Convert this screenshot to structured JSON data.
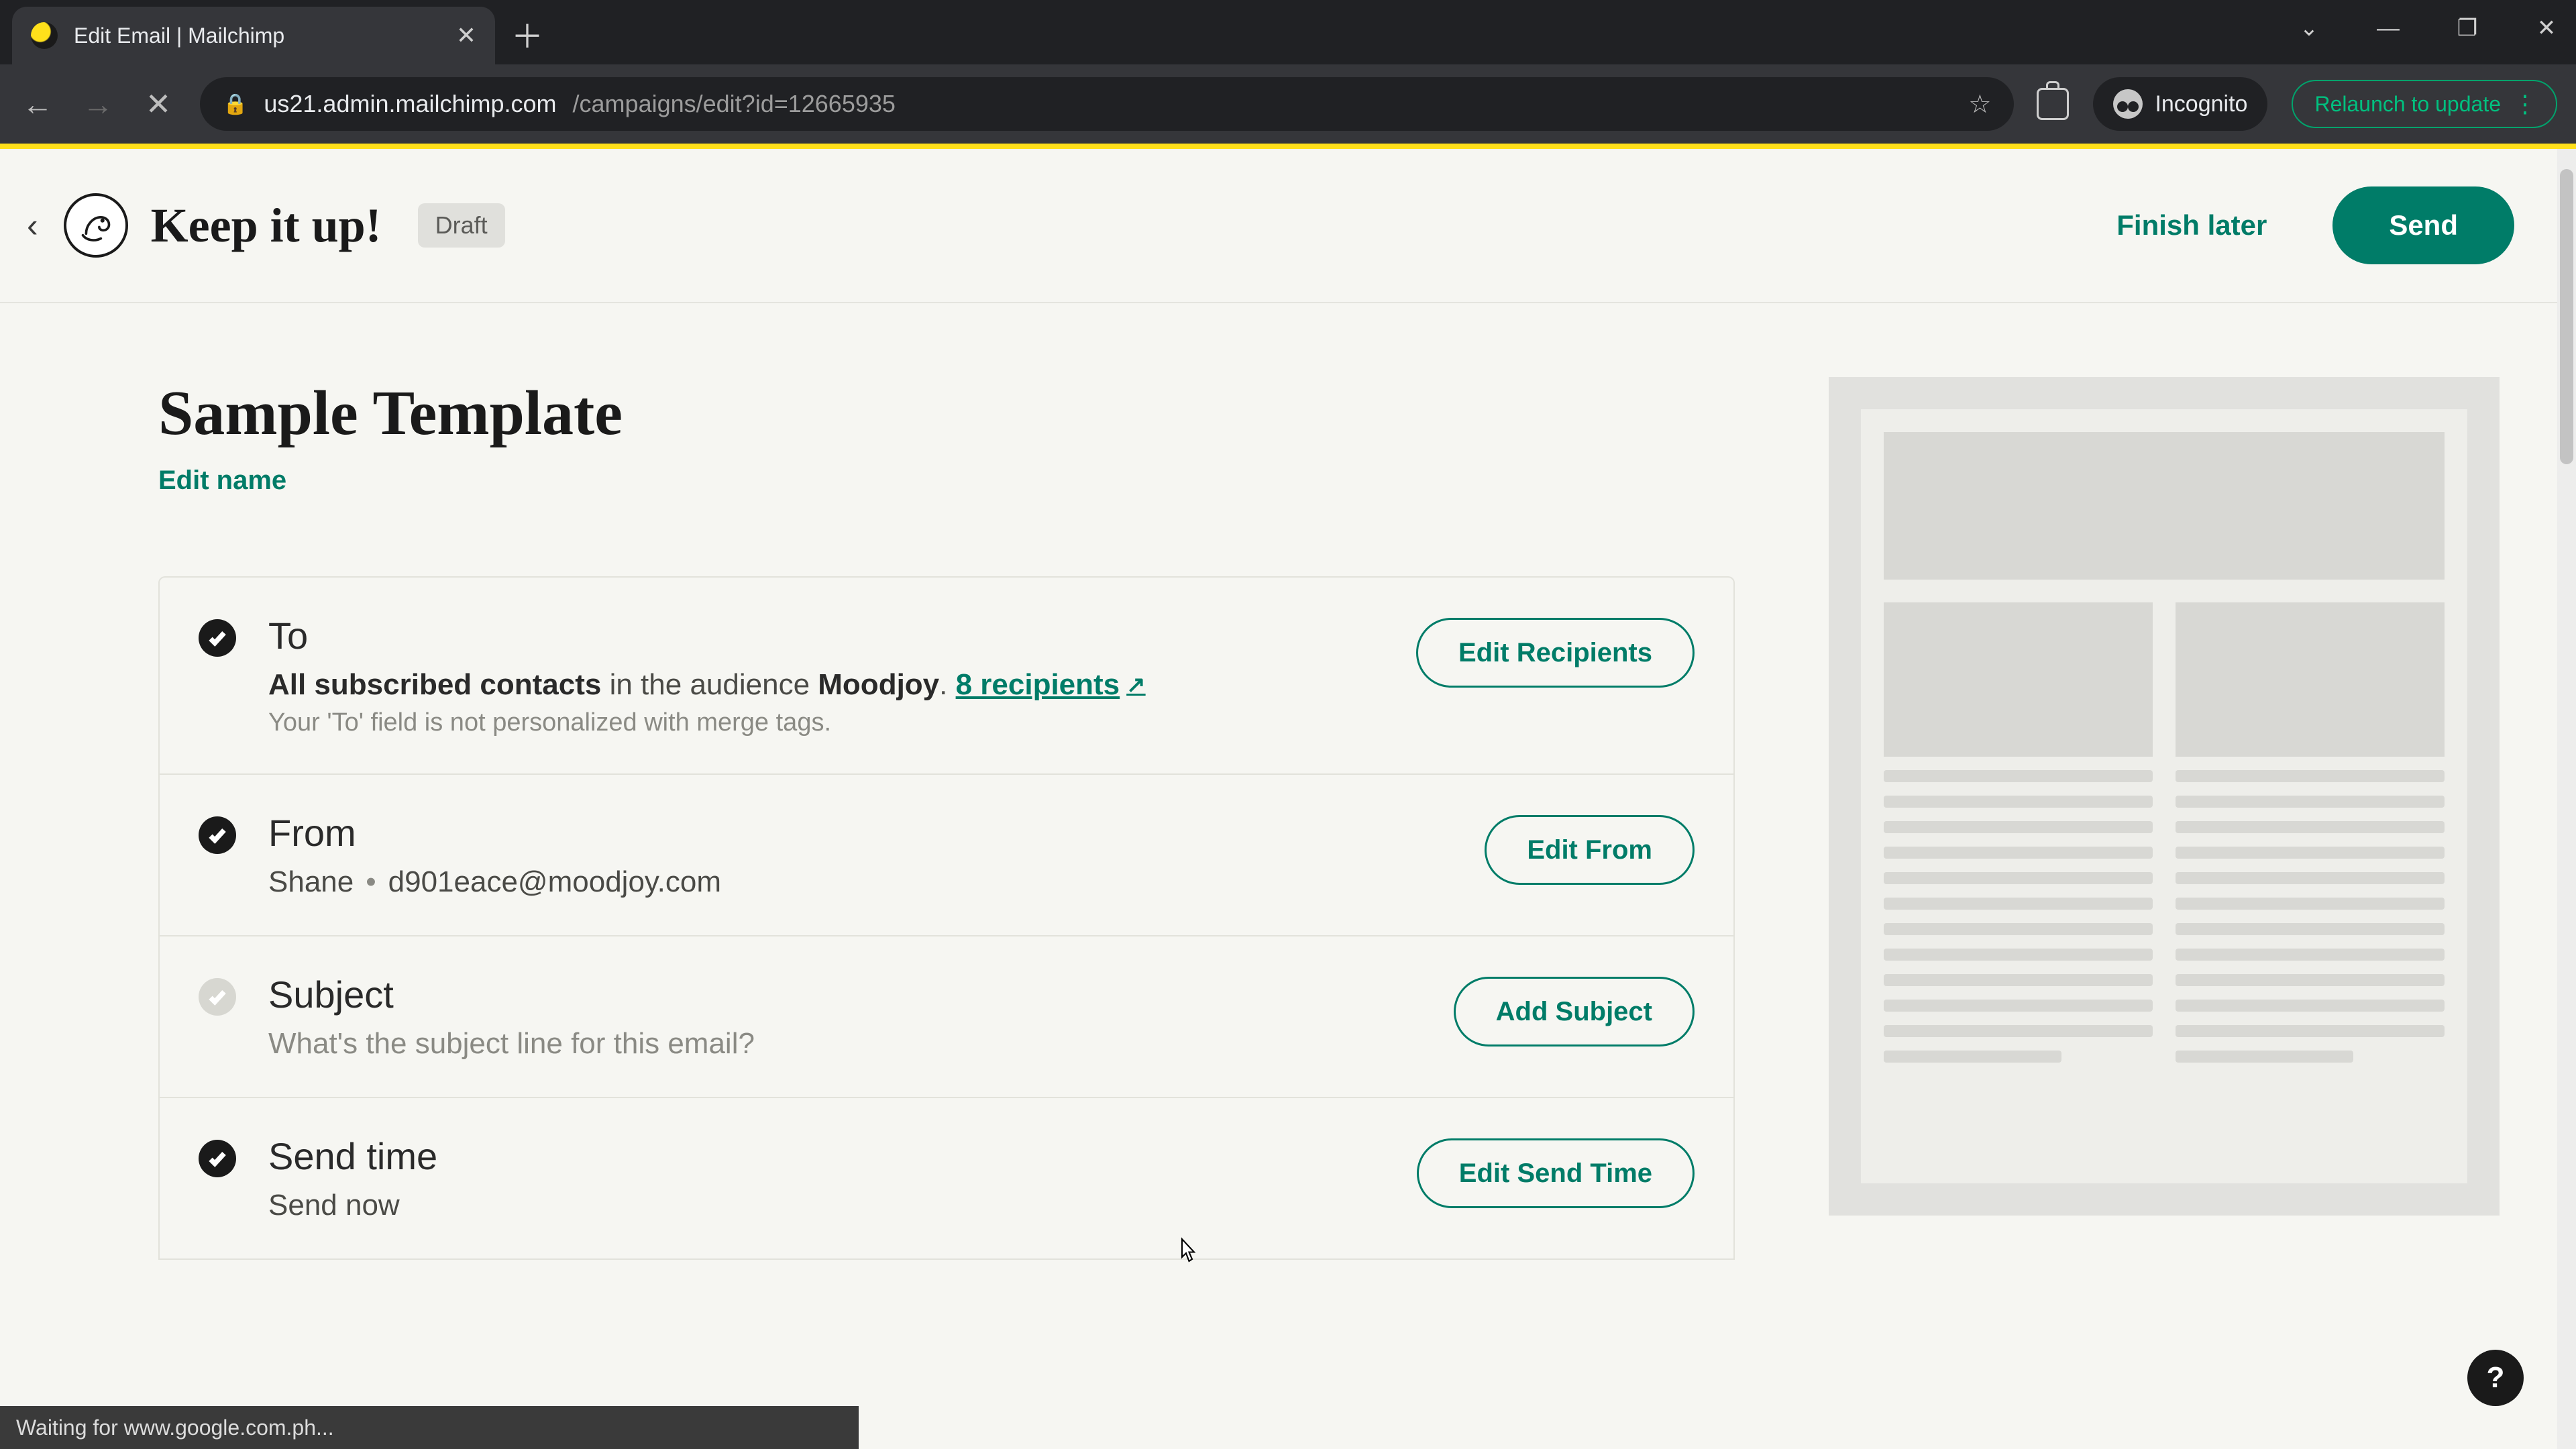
{
  "browser": {
    "tab_title": "Edit Email | Mailchimp",
    "url_host": "us21.admin.mailchimp.com",
    "url_path": "/campaigns/edit?id=12665935",
    "incognito_label": "Incognito",
    "relaunch_label": "Relaunch to update",
    "status_bar": "Waiting for www.google.com.ph..."
  },
  "header": {
    "campaign_title": "Keep it up!",
    "status_badge": "Draft",
    "finish_later": "Finish later",
    "send": "Send"
  },
  "main": {
    "template_name": "Sample Template",
    "edit_name": "Edit name",
    "sections": {
      "to": {
        "title": "To",
        "line_strong": "All subscribed contacts",
        "line_mid": " in the audience ",
        "audience": "Moodjoy",
        "period": ".  ",
        "recipients_link": "8 recipients",
        "note": "Your 'To' field is not personalized with merge tags.",
        "action": "Edit Recipients"
      },
      "from": {
        "title": "From",
        "name": "Shane",
        "email": "d901eace@moodjoy.com",
        "action": "Edit From"
      },
      "subject": {
        "title": "Subject",
        "placeholder": "What's the subject line for this email?",
        "action": "Add Subject"
      },
      "send_time": {
        "title": "Send time",
        "value": "Send now",
        "action": "Edit Send Time"
      }
    }
  },
  "help_label": "?"
}
